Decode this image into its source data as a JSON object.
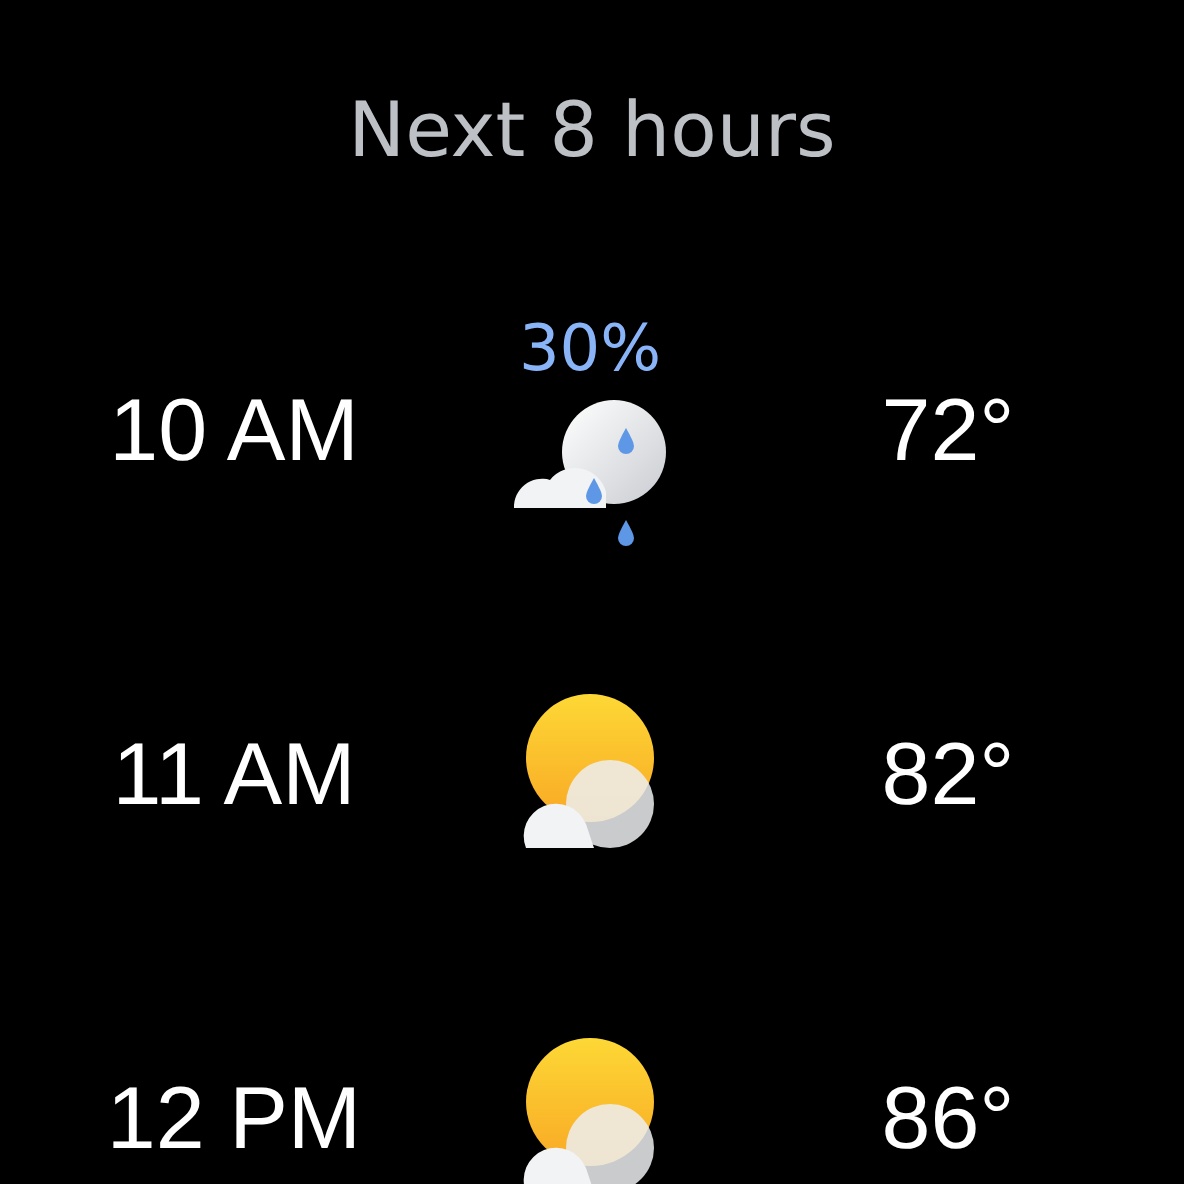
{
  "title": "Next 8 hours",
  "hours": [
    {
      "time": "10 AM",
      "precipitation": "30%",
      "kind": "rain",
      "temperature": "72°"
    },
    {
      "time": "11 AM",
      "kind": "partly_cloudy",
      "temperature": "82°"
    },
    {
      "time": "12 PM",
      "kind": "partly_cloudy",
      "temperature": "86°"
    }
  ]
}
